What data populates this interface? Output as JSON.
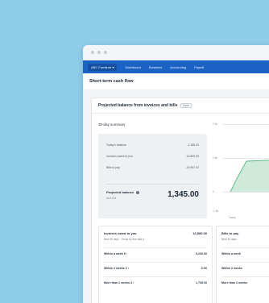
{
  "navbar": {
    "org": "ABC Furniture ▾",
    "items": [
      "Dashboard",
      "Business",
      "Accounting",
      "Payroll"
    ]
  },
  "page": {
    "title": "Short-term cash flow"
  },
  "card": {
    "title": "Projected balance from invoices and bills",
    "tag": "Beta",
    "summary_title": "30-day summary",
    "rows": [
      {
        "label": "Today's balance",
        "value": "-1,185.00"
      },
      {
        "label": "Invoices owed to you",
        "value": "13,890.00"
      },
      {
        "label": "Bills to pay",
        "value": "-13,957.00"
      }
    ],
    "projected_label": "Projected balance",
    "projected_sub": "on 4 Oct",
    "projected_value": "1,345.00"
  },
  "chart": {
    "y_ticks": [
      "2.5k",
      "1.5k",
      "0",
      "-1.5k"
    ],
    "x_label": "Today",
    "color_area": "#cfeadb",
    "color_line": "#5cbf8a"
  },
  "invoices_panel": {
    "title": "Invoices owed to you",
    "value": "13,890.00",
    "sub": "Next 30 days · Group by due date ▾",
    "rows": [
      {
        "label": "Within a week  5 ›",
        "value": "3,230.00"
      },
      {
        "label": "Within 2 weeks  0 ›",
        "value": "0.00"
      },
      {
        "label": "More than 2 weeks  4 ›",
        "value": "1,735.00"
      }
    ]
  },
  "bills_panel": {
    "title": "Bills to pay",
    "sub": "Next 30 days",
    "rows": [
      {
        "label": "Within a week"
      },
      {
        "label": "Within 2 weeks"
      },
      {
        "label": "More than 2 weeks"
      }
    ]
  }
}
